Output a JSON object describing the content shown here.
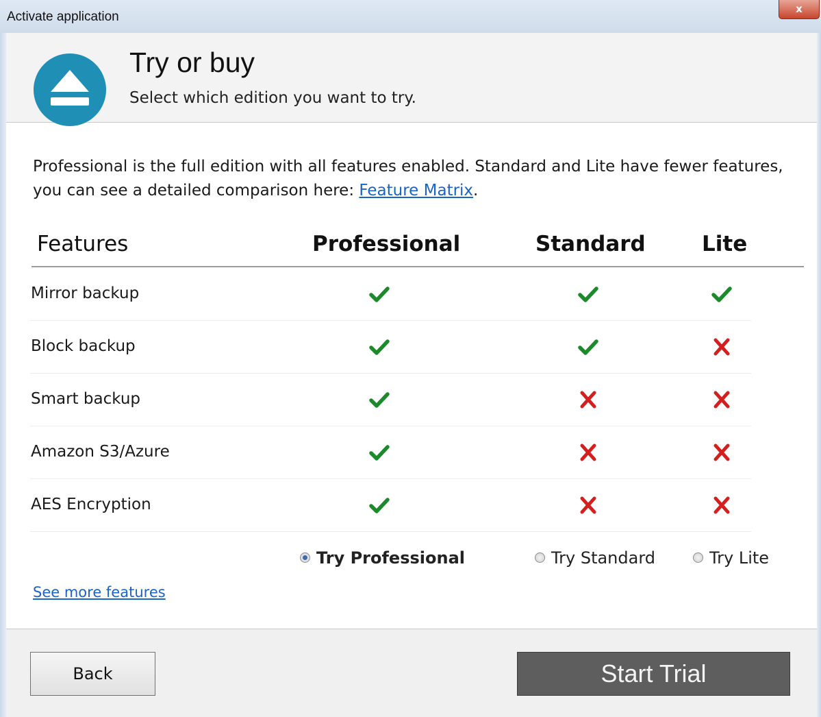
{
  "window": {
    "title": "Activate application",
    "close_label": "x"
  },
  "header": {
    "title": "Try or buy",
    "subtitle": "Select which edition you want to try."
  },
  "intro": {
    "text": "Professional is the full edition with all features enabled. Standard and Lite have fewer features, you can see a detailed comparison here: ",
    "link_text": "Feature Matrix",
    "suffix": "."
  },
  "table": {
    "headers": {
      "features": "Features",
      "professional": "Professional",
      "standard": "Standard",
      "lite": "Lite"
    },
    "rows": [
      {
        "feature": "Mirror backup",
        "professional": "check-icon",
        "standard": "check-icon",
        "lite": "check-icon"
      },
      {
        "feature": "Block backup",
        "professional": "check-icon",
        "standard": "check-icon",
        "lite": "cross-icon"
      },
      {
        "feature": "Smart backup",
        "professional": "check-icon",
        "standard": "cross-icon",
        "lite": "cross-icon"
      },
      {
        "feature": "Amazon S3/Azure",
        "professional": "check-icon",
        "standard": "cross-icon",
        "lite": "cross-icon"
      },
      {
        "feature": "AES Encryption",
        "professional": "check-icon",
        "standard": "cross-icon",
        "lite": "cross-icon"
      }
    ]
  },
  "options": {
    "try_professional": "Try Professional",
    "try_standard": "Try Standard",
    "try_lite": "Try Lite",
    "selected": "professional"
  },
  "see_more": "See more features",
  "buttons": {
    "back": "Back",
    "start": "Start Trial"
  },
  "colors": {
    "check": "#1a8a2a",
    "cross": "#d41f1f",
    "brand": "#1f8fb6",
    "link": "#1a63c7"
  }
}
